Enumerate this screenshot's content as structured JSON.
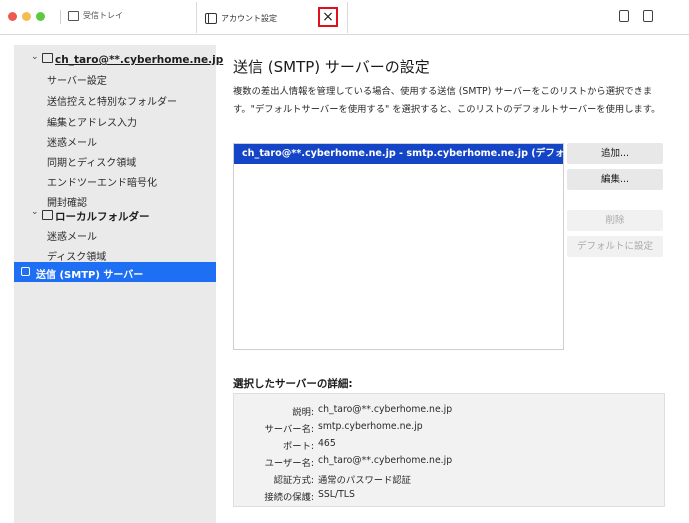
{
  "window": {
    "inbox_tab_label": "受信トレイ",
    "active_tab_label": "アカウント設定",
    "close_symbol": "×"
  },
  "sidebar": {
    "account": "ch_taro@**.cyberhome.ne.jp",
    "account_items": [
      "サーバー設定",
      "送信控えと特別なフォルダー",
      "編集とアドレス入力",
      "迷惑メール",
      "同期とディスク領域",
      "エンドツーエンド暗号化",
      "開封確認"
    ],
    "local_folders": "ローカルフォルダー",
    "local_items": [
      "迷惑メール",
      "ディスク領域"
    ],
    "selected_item": "送信 (SMTP) サーバー"
  },
  "main": {
    "title": "送信 (SMTP) サーバーの設定",
    "description": "複数の差出人情報を管理している場合、使用する送信 (SMTP) サーバーをこのリストから選択できます。\"デフォルトサーバーを使用する\" を選択すると、このリストのデフォルトサーバーを使用します。",
    "server_list": [
      "ch_taro@**.cyberhome.ne.jp - smtp.cyberhome.ne.jp (デフォルト)"
    ],
    "buttons": {
      "add": "追加...",
      "edit": "編集...",
      "delete": "削除",
      "set_default": "デフォルトに設定"
    },
    "details_title": "選択したサーバーの詳細:",
    "details": [
      {
        "label": "説明:",
        "value": "ch_taro@**.cyberhome.ne.jp"
      },
      {
        "label": "サーバー名:",
        "value": "smtp.cyberhome.ne.jp"
      },
      {
        "label": "ポート:",
        "value": "465"
      },
      {
        "label": "ユーザー名:",
        "value": "ch_taro@**.cyberhome.ne.jp"
      },
      {
        "label": "認証方式:",
        "value": "通常のパスワード認証"
      },
      {
        "label": "接続の保護:",
        "value": "SSL/TLS"
      }
    ]
  },
  "colors": {
    "selection_blue": "#1f6ff5",
    "list_selection": "#1545c7",
    "highlight_red": "#e0111e"
  }
}
